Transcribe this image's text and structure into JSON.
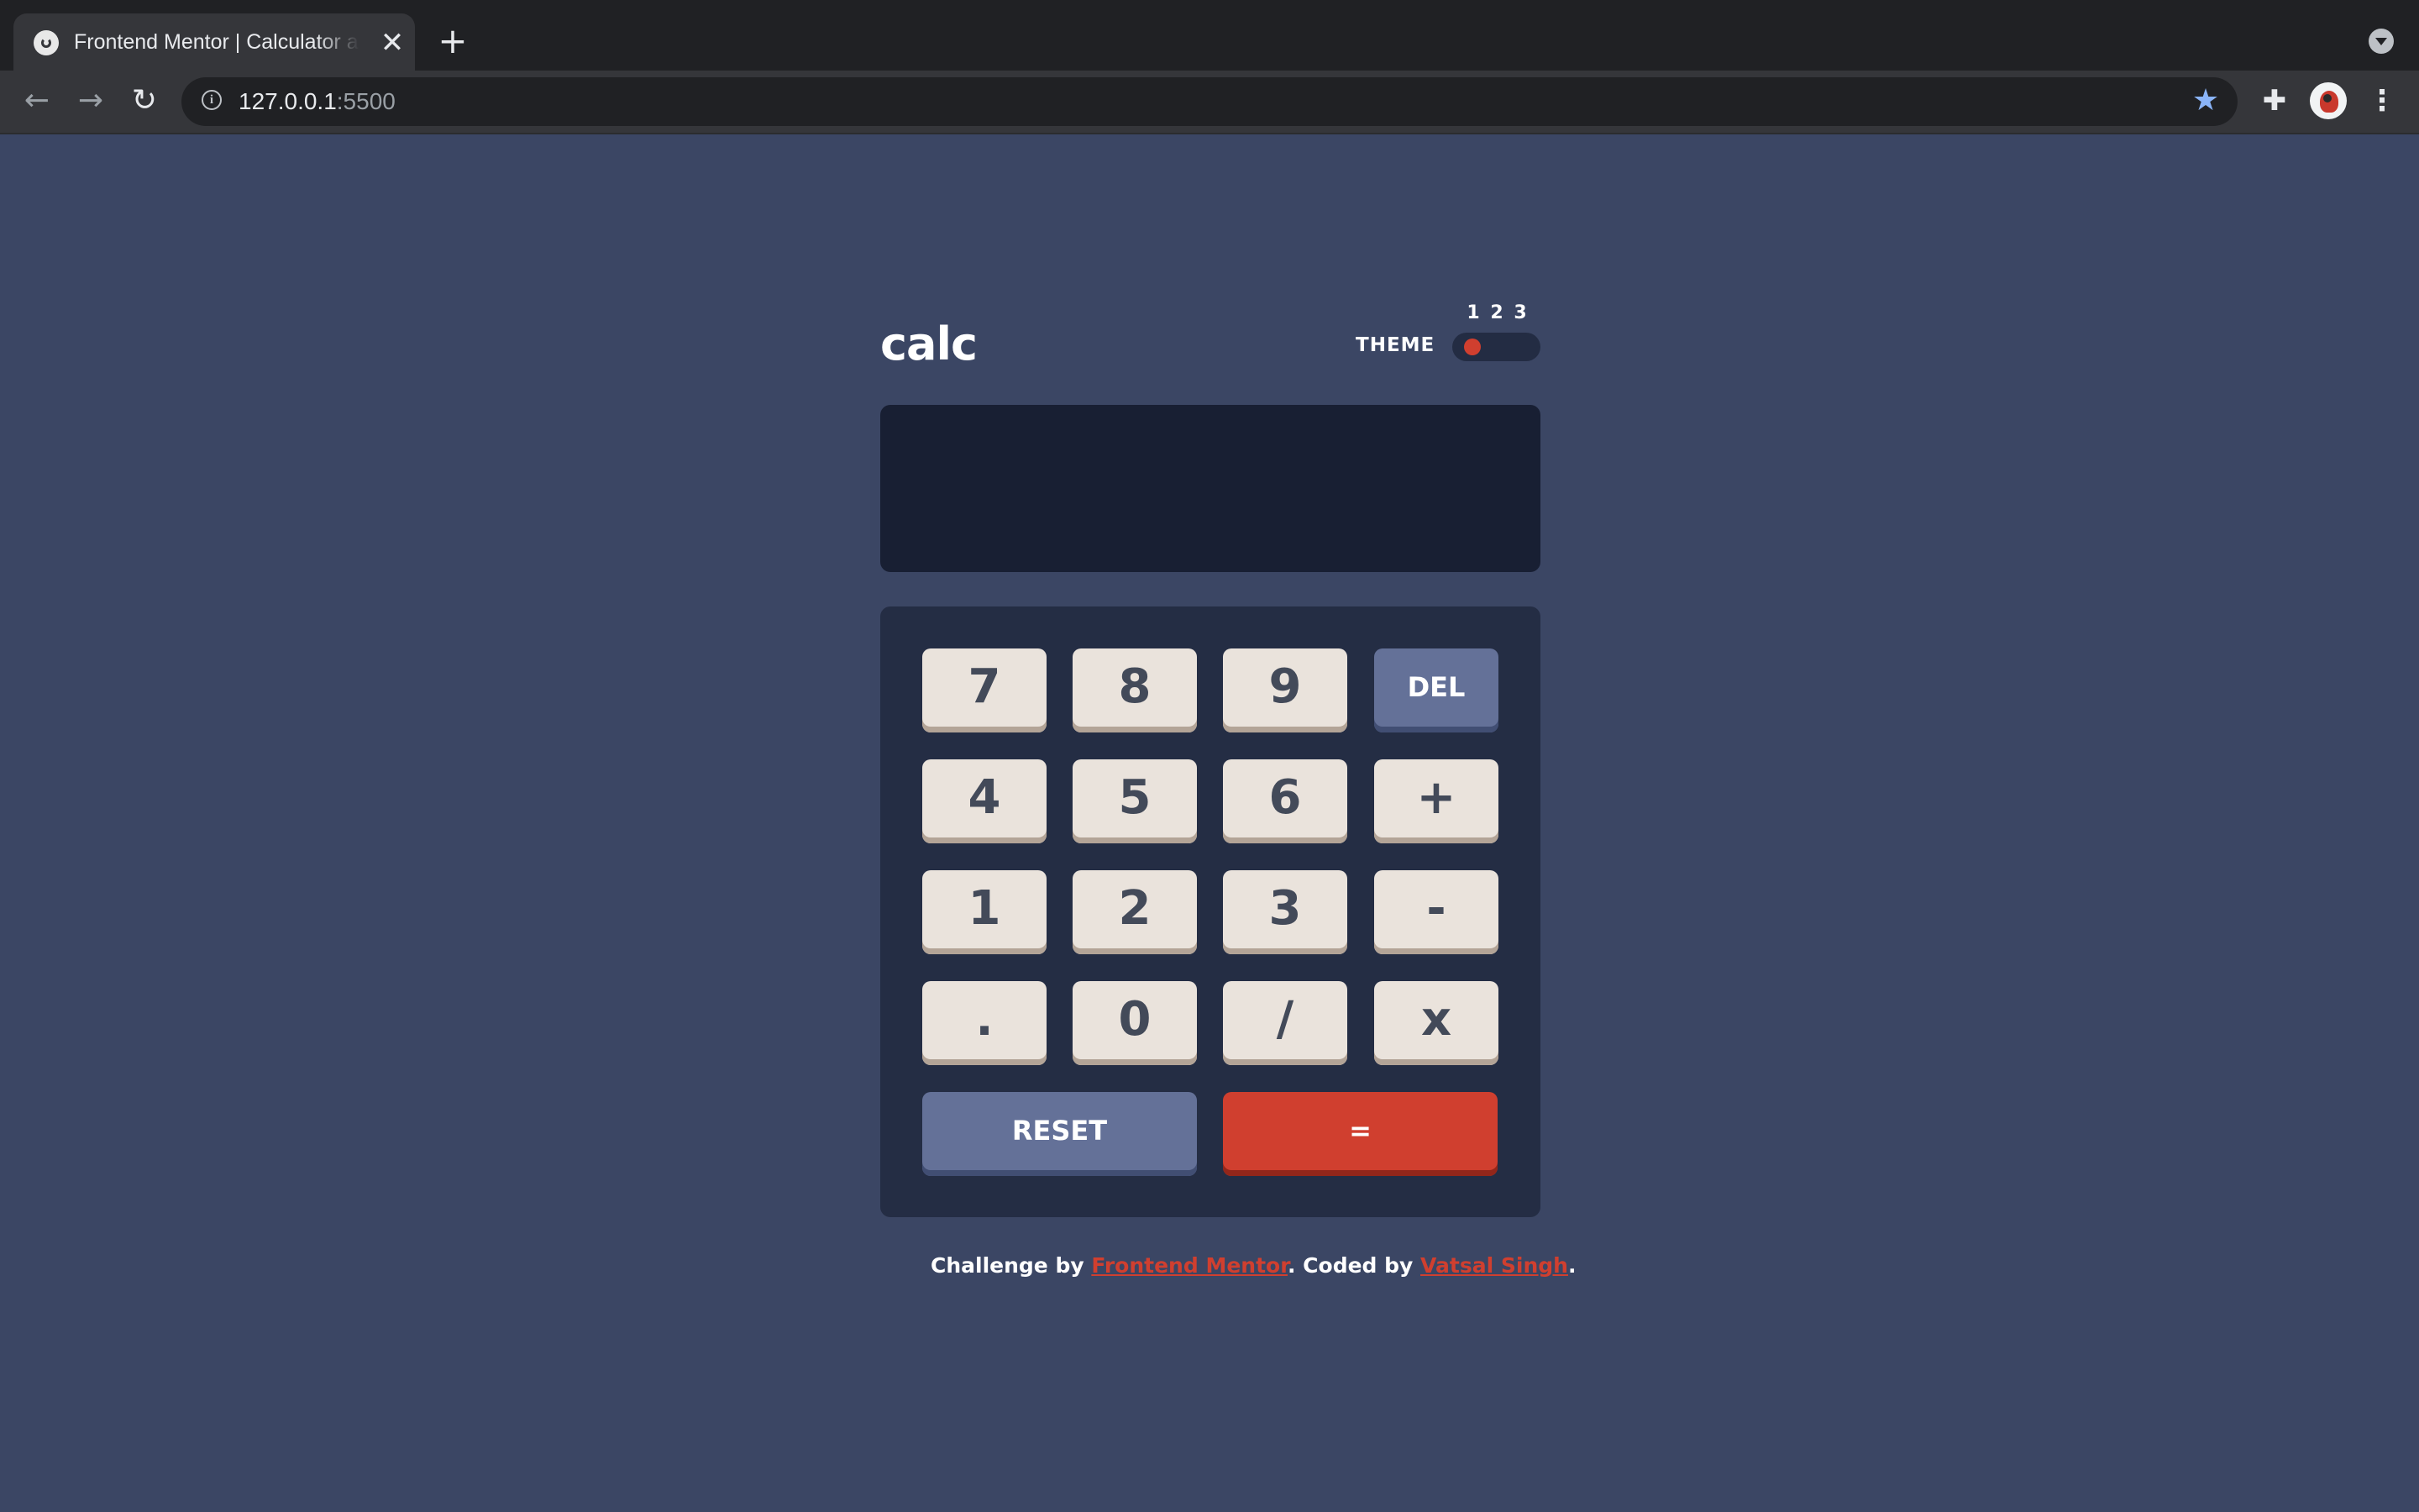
{
  "browser": {
    "tab_title": "Frontend Mentor | Calculator app",
    "tab_close": "✕",
    "new_tab": "+",
    "url_host": "127.0.0.1",
    "url_port": ":5500",
    "icons": [
      "back-arrow-icon",
      "forward-arrow-icon",
      "reload-icon",
      "info-icon",
      "star-icon",
      "extensions-icon",
      "profile-avatar",
      "kebab-menu-icon"
    ]
  },
  "calculator": {
    "logo": "calc",
    "theme_label": "THEME",
    "theme_options": [
      "1",
      "2",
      "3"
    ],
    "selected_theme": 1,
    "display_value": "",
    "keys": {
      "row1": [
        "7",
        "8",
        "9",
        "DEL"
      ],
      "row2": [
        "4",
        "5",
        "6",
        "+"
      ],
      "row3": [
        "1",
        "2",
        "3",
        "-"
      ],
      "row4": [
        ".",
        "0",
        "/",
        "x"
      ],
      "reset": "RESET",
      "equals": "="
    },
    "colors": {
      "background": "#3b4664",
      "keypad": "#242d44",
      "screen": "#181f33",
      "key": "#eae3dc",
      "accent_blue": "#647198",
      "accent_red": "#d03f2f"
    }
  },
  "footer": {
    "prefix": "Challenge by ",
    "link1": "Frontend Mentor",
    "middle": ". Coded by ",
    "link2": "Vatsal Singh",
    "suffix": "."
  }
}
